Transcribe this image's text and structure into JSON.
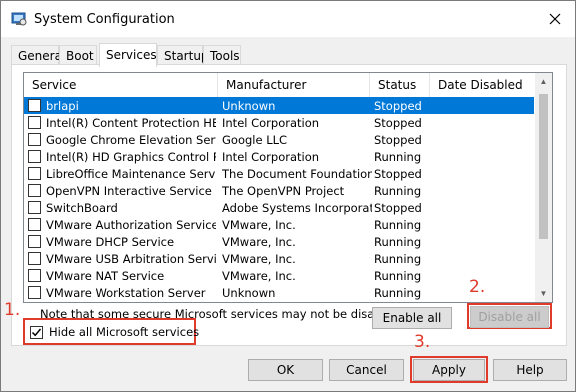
{
  "window": {
    "title": "System Configuration"
  },
  "tabs": [
    {
      "label": "General"
    },
    {
      "label": "Boot"
    },
    {
      "label": "Services"
    },
    {
      "label": "Startup"
    },
    {
      "label": "Tools"
    }
  ],
  "table": {
    "columns": [
      "Service",
      "Manufacturer",
      "Status",
      "Date Disabled"
    ],
    "rows": [
      {
        "service": "brlapi",
        "manufacturer": "Unknown",
        "status": "Stopped",
        "date": ""
      },
      {
        "service": "Intel(R) Content Protection HEC...",
        "manufacturer": "Intel Corporation",
        "status": "Stopped",
        "date": ""
      },
      {
        "service": "Google Chrome Elevation Servic...",
        "manufacturer": "Google LLC",
        "status": "Stopped",
        "date": ""
      },
      {
        "service": "Intel(R) HD Graphics Control Pa...",
        "manufacturer": "Intel Corporation",
        "status": "Running",
        "date": ""
      },
      {
        "service": "LibreOffice Maintenance Service",
        "manufacturer": "The Document Foundation",
        "status": "Stopped",
        "date": ""
      },
      {
        "service": "OpenVPN Interactive Service",
        "manufacturer": "The OpenVPN Project",
        "status": "Running",
        "date": ""
      },
      {
        "service": "SwitchBoard",
        "manufacturer": "Adobe Systems Incorporated",
        "status": "Stopped",
        "date": ""
      },
      {
        "service": "VMware Authorization Service",
        "manufacturer": "VMware, Inc.",
        "status": "Running",
        "date": ""
      },
      {
        "service": "VMware DHCP Service",
        "manufacturer": "VMware, Inc.",
        "status": "Running",
        "date": ""
      },
      {
        "service": "VMware USB Arbitration Service",
        "manufacturer": "VMware, Inc.",
        "status": "Running",
        "date": ""
      },
      {
        "service": "VMware NAT Service",
        "manufacturer": "VMware, Inc.",
        "status": "Running",
        "date": ""
      },
      {
        "service": "VMware Workstation Server",
        "manufacturer": "Unknown",
        "status": "Running",
        "date": ""
      }
    ],
    "selected_index": 0
  },
  "note": "Note that some secure Microsoft services may not be disabled.",
  "hide_ms": {
    "label": "Hide all Microsoft services",
    "checked": true
  },
  "buttons": {
    "enable_all": "Enable all",
    "disable_all": "Disable all",
    "ok": "OK",
    "cancel": "Cancel",
    "apply": "Apply",
    "help": "Help"
  },
  "annotations": {
    "step1": "1.",
    "step2": "2.",
    "step3": "3."
  },
  "colors": {
    "annotation": "#e03a2a",
    "selection": "#0078d7"
  },
  "icons": {
    "app": "system-config-icon",
    "close": "close-icon",
    "check": "checkmark-icon"
  }
}
